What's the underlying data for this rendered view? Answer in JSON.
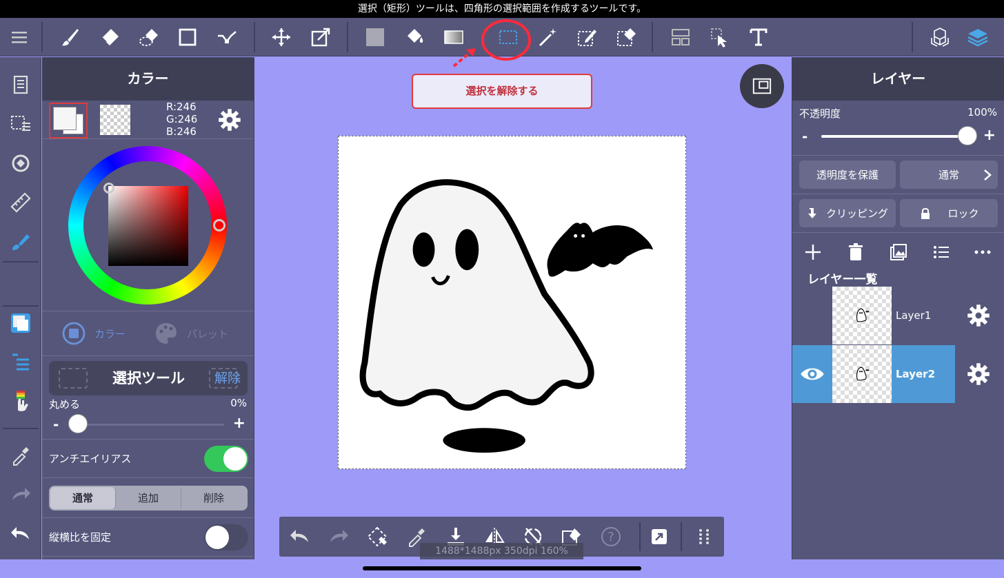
{
  "hint": "選択（矩形）ツールは、四角形の選択範囲を作成するツールです。",
  "toolbar": {
    "tools": [
      "menu-icon",
      "brush-icon",
      "eraser-icon",
      "blur-eraser-icon",
      "rectangle-icon",
      "connect-icon",
      "move-icon",
      "transform-icon",
      "fill-color-icon",
      "bucket-icon",
      "gradient-icon",
      "select-rect-icon",
      "magic-wand-icon",
      "select-pen-icon",
      "select-eraser-icon",
      "divide-icon",
      "select-move-icon",
      "text-icon",
      "3d-icon",
      "layers-icon"
    ]
  },
  "color_panel": {
    "title": "カラー",
    "rgb": {
      "r": "R:246",
      "g": "G:246",
      "b": "B:246"
    },
    "tabs": {
      "color": "カラー",
      "palette": "パレット"
    },
    "selection_tool": {
      "title": "選択ツール",
      "clear": "解除"
    },
    "round": {
      "label": "丸める",
      "value": "0%",
      "level": 0
    },
    "antialias": {
      "label": "アンチエイリアス",
      "on": true
    },
    "modes": [
      "通常",
      "追加",
      "削除"
    ],
    "active_mode": "通常",
    "aspect": {
      "label": "縦横比を固定",
      "on": false
    }
  },
  "canvas": {
    "deselect_label": "選択を解除する",
    "doc_info": "1488*1488px 350dpi 160%"
  },
  "layer_panel": {
    "title": "レイヤー",
    "opacity": {
      "label": "不透明度",
      "value": "100%",
      "level": 1.0
    },
    "protect_alpha": "透明度を保護",
    "blend_mode": "通常",
    "clipping": "クリッピング",
    "lock": "ロック",
    "list_title": "レイヤー一覧",
    "layers": [
      {
        "name": "Layer1",
        "active": false
      },
      {
        "name": "Layer2",
        "active": true
      }
    ]
  },
  "colors": {
    "toolbar": "#55567a",
    "canvas_bg": "#9e9af8",
    "accent": "#4f9ad6",
    "highlight": "#e03a3a"
  }
}
